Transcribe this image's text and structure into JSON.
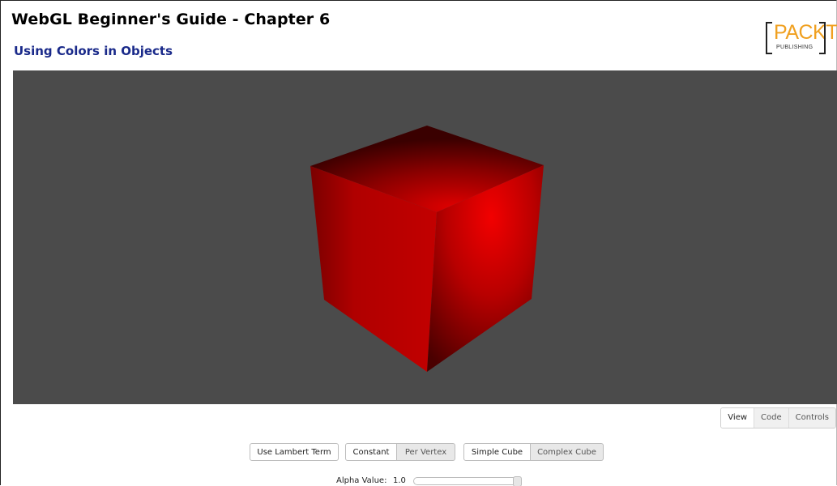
{
  "header": {
    "title": "WebGL Beginner's Guide - Chapter 6",
    "subtitle": "Using Colors in Objects"
  },
  "logo": {
    "word": "PACKT",
    "tagline": "PUBLISHING",
    "color": "#f0a020"
  },
  "viewport": {
    "background": "#4b4b4b",
    "cube_color": "#e80000"
  },
  "tabs": [
    {
      "label": "View",
      "active": true
    },
    {
      "label": "Code",
      "active": false
    },
    {
      "label": "Controls",
      "active": false
    }
  ],
  "controls": {
    "lambert_label": "Use Lambert Term",
    "color_mode": {
      "options": [
        "Constant",
        "Per Vertex"
      ],
      "selected": "Constant"
    },
    "object": {
      "options": [
        "Simple Cube",
        "Complex Cube"
      ],
      "selected": "Simple Cube"
    },
    "alpha": {
      "label": "Alpha Value:",
      "value_text": "1.0",
      "value": 1.0,
      "min": 0.0,
      "max": 1.0
    }
  }
}
